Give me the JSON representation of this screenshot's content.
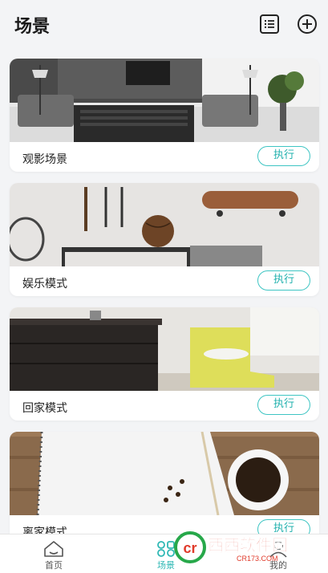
{
  "header": {
    "title": "场景",
    "list_icon": "list-icon",
    "add_icon": "plus-circle-icon"
  },
  "scenes": [
    {
      "name": "观影场景",
      "button": "执行",
      "image": "living-room-photo"
    },
    {
      "name": "娱乐模式",
      "button": "执行",
      "image": "sports-gear-wall-photo"
    },
    {
      "name": "回家模式",
      "button": "执行",
      "image": "dresser-and-chair-photo"
    },
    {
      "name": "离家模式",
      "button": "执行",
      "image": "notebook-and-coffee-photo"
    }
  ],
  "tabbar": {
    "tabs": [
      {
        "label": "首页",
        "icon": "home-icon"
      },
      {
        "label": "场景",
        "icon": "scene-icon",
        "active": true
      },
      {
        "label": "我的",
        "icon": "user-icon"
      }
    ]
  },
  "watermark": {
    "text": "西西软件园",
    "sub": "CR173.COM",
    "logo": "cr"
  },
  "colors": {
    "accent": "#2fb8b5",
    "background": "#f3f4f6"
  }
}
